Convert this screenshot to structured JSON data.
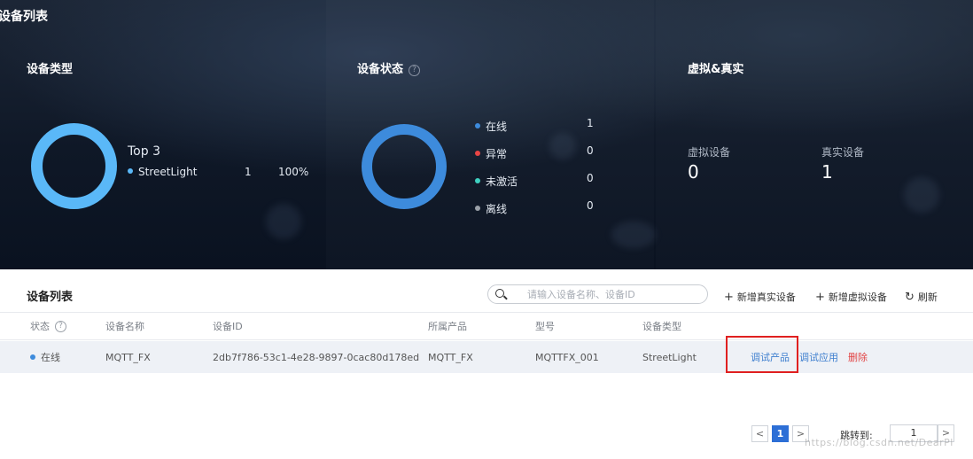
{
  "dashboard": {
    "title": "设备列表",
    "device_type": {
      "title": "设备类型",
      "top_label": "Top 3",
      "legend": [
        {
          "name": "StreetLight",
          "count": "1",
          "percent": "100%",
          "color": "#5ab8f8"
        }
      ]
    },
    "device_status": {
      "title": "设备状态",
      "help_icon": "?",
      "items": [
        {
          "label": "在线",
          "value": "1",
          "color": "#3d8bdc"
        },
        {
          "label": "异常",
          "value": "0",
          "color": "#e84545"
        },
        {
          "label": "未激活",
          "value": "0",
          "color": "#3fd0c0"
        },
        {
          "label": "离线",
          "value": "0",
          "color": "#9aa0a8"
        }
      ]
    },
    "virtual_real": {
      "title": "虚拟&真实",
      "virtual_label": "虚拟设备",
      "virtual_value": "0",
      "real_label": "真实设备",
      "real_value": "1"
    }
  },
  "device_list": {
    "title": "设备列表",
    "search_placeholder": "请输入设备名称、设备ID",
    "actions": {
      "add_real": "新增真实设备",
      "add_virtual": "新增虚拟设备",
      "refresh": "刷新"
    },
    "columns": [
      "状态",
      "设备名称",
      "设备ID",
      "所属产品",
      "型号",
      "设备类型"
    ],
    "status_help": "?",
    "rows": [
      {
        "status": "在线",
        "status_color": "#3d8bdc",
        "name": "MQTT_FX",
        "device_id": "2db7f786-53c1-4e28-9897-0cac80d178ed",
        "product": "MQTT_FX",
        "model": "MQTTFX_001",
        "type": "StreetLight",
        "op_debug_product": "调试产品",
        "op_debug_app": "调试应用",
        "op_delete": "删除"
      }
    ],
    "pagination": {
      "prev": "<",
      "current": "1",
      "next": ">",
      "jump_label": "跳转到:",
      "jump_value": "1",
      "jump_next": ">"
    }
  },
  "watermark": "https://blog.csdn.net/DearPl"
}
